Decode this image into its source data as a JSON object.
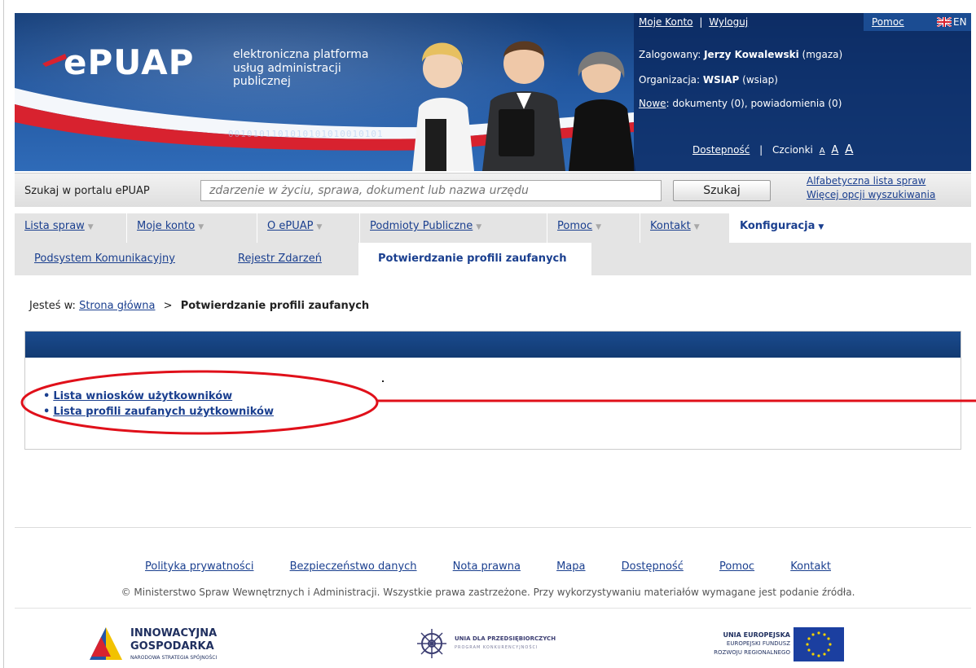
{
  "header": {
    "logo_text": "ePUAP",
    "logo_sub1": "elektroniczna platforma",
    "logo_sub2": "usług administracji publicznej",
    "binary": "0010101101010101010010101",
    "account_link": "Moje Konto",
    "logout_link": "Wyloguj",
    "help_link": "Pomoc",
    "lang_label": "EN",
    "logged_prefix": "Zalogowany:",
    "user_name": "Jerzy Kowalewski",
    "user_login": "(mgaza)",
    "org_prefix": "Organizacja:",
    "org_name": "WSIAP",
    "org_code": "(wsiap)",
    "new_link": "Nowe",
    "new_text": ": dokumenty (0), powiadomienia (0)",
    "accessibility_link": "Dostepność",
    "fonts_label": "Czcionki",
    "font_small": "A",
    "font_medium": "A",
    "font_large": "A"
  },
  "search": {
    "label": "Szukaj w portalu ePUAP",
    "placeholder": "zdarzenie w życiu, sprawa, dokument lub nazwa urzędu",
    "button": "Szukaj",
    "link_alphabetical": "Alfabetyczna lista spraw",
    "link_more": "Więcej opcji wyszukiwania"
  },
  "menu": {
    "items": [
      {
        "label": "Lista spraw"
      },
      {
        "label": "Moje konto"
      },
      {
        "label": "O ePUAP"
      },
      {
        "label": "Podmioty Publiczne"
      },
      {
        "label": "Pomoc"
      },
      {
        "label": "Kontakt"
      },
      {
        "label": "Konfiguracja"
      }
    ],
    "active_index": 6
  },
  "submenu": {
    "items": [
      {
        "label": "Podsystem Komunikacyjny"
      },
      {
        "label": "Rejestr Zdarzeń"
      },
      {
        "label": "Potwierdzanie profili zaufanych"
      }
    ],
    "active_index": 2
  },
  "breadcrumb": {
    "prefix": "Jesteś w:",
    "home": "Strona główna",
    "separator": ">",
    "current": "Potwierdzanie profili zaufanych"
  },
  "panel": {
    "links": [
      "Lista wniosków użytkowników",
      "Lista profili zaufanych użytkowników"
    ]
  },
  "footer": {
    "links": [
      "Polityka prywatności",
      "Bezpieczeństwo danych",
      "Nota prawna",
      "Mapa",
      "Dostępność",
      "Pomoc",
      "Kontakt"
    ],
    "copyright": "© Ministerstwo Spraw Wewnętrznych i Administracji. Wszystkie prawa zastrzeżone. Przy wykorzystywaniu materiałów wymagane jest podanie źródła.",
    "logo_ig_line1": "INNOWACYJNA",
    "logo_ig_line2": "GOSPODARKA",
    "logo_ig_line3": "NARODOWA STRATEGIA SPÓJNOŚCI",
    "logo_udp_line1": "UNIA DLA PRZEDSIĘBIORCZYCH",
    "logo_udp_line2": "PROGRAM KONKURENCYJNOŚCI",
    "logo_ue_line1": "UNIA EUROPEJSKA",
    "logo_ue_line2": "EUROPEJSKI FUNDUSZ",
    "logo_ue_line3": "ROZWOJU REGIONALNEGO"
  },
  "colors": {
    "header_blue": "#2257a0",
    "link_blue": "#1a3f8f",
    "panel_header": "#1a4b8e",
    "annotation_red": "#e0101a",
    "menu_gray": "#e4e4e4"
  }
}
